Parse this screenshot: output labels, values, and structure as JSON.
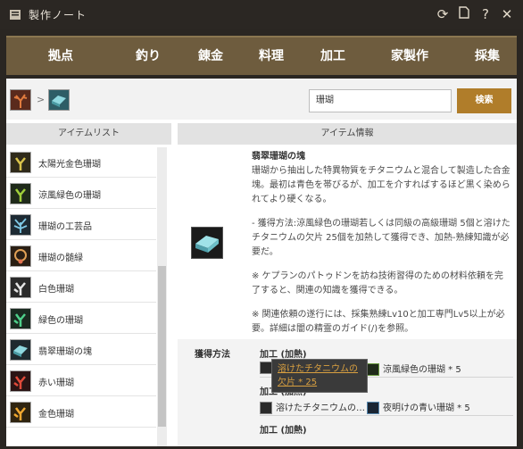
{
  "window": {
    "title": "製作ノート",
    "icons": [
      "refresh-icon",
      "document-icon",
      "help-icon",
      "close-icon"
    ]
  },
  "nav": {
    "items": [
      "拠点",
      "釣り",
      "錬金",
      "料理",
      "加工",
      "家製作",
      "採集"
    ]
  },
  "breadcrumb": {
    "separator": ">"
  },
  "search": {
    "value": "珊瑚",
    "button_label": "検索"
  },
  "item_list": {
    "header": "アイテムリスト",
    "items": [
      {
        "label": "太陽光金色珊瑚",
        "icon": "gold-coral-icon"
      },
      {
        "label": "涼風緑色の珊瑚",
        "icon": "green-coral-icon"
      },
      {
        "label": "珊瑚の工芸品",
        "icon": "coral-craft-icon"
      },
      {
        "label": "珊瑚の髄緑",
        "icon": "coral-necklace-icon"
      },
      {
        "label": "白色珊瑚",
        "icon": "white-coral-icon"
      },
      {
        "label": "緑色の珊瑚",
        "icon": "green-coral-icon"
      },
      {
        "label": "翡翠珊瑚の塊",
        "icon": "jade-coral-ingot-icon"
      },
      {
        "label": "赤い珊瑚",
        "icon": "red-coral-icon"
      },
      {
        "label": "金色珊瑚",
        "icon": "gold-coral-icon"
      }
    ]
  },
  "item_info": {
    "header": "アイテム情報",
    "name": "翡翠珊瑚の塊",
    "paragraphs": [
      "珊瑚から抽出した特異物質をチタニウムと混合して製造した合金塊。最初は青色を帯びるが、加工を介すればするほど黒く染められてより硬くなる。",
      "- 獲得方法:涼風緑色の珊瑚若しくは同級の高級珊瑚 5個と溶けたチタニウムの欠片 25個を加熱して獲得でき、加熱-熟練知識が必要だ。",
      "※ ケプランのパトゥドンを訪ね技術習得のための材料依頼を完了すると、関連の知識を獲得できる。",
      "※ 関連依頼の遂行には、採集熟練Lv10と加工専門Lv5以上が必要。詳細は闇の精霊のガイド(/)を参照。"
    ]
  },
  "acquisition": {
    "label": "獲得方法",
    "sections": [
      {
        "title": "加工 (加熱)",
        "materials": [
          "涼風緑色の珊瑚 * 5"
        ]
      },
      {
        "title": "加工 (加熱)",
        "materials": [
          "溶けたチタニウムの…",
          "夜明けの青い珊瑚 * 5"
        ]
      },
      {
        "title": "加工 (加熱)",
        "materials": []
      }
    ],
    "tooltip": "溶けたチタニウムの欠片 * 25"
  },
  "colors": {
    "nav_bg": "#6e5c3e",
    "accent": "#b07d2a",
    "tooltip_text": "#d9a040"
  }
}
